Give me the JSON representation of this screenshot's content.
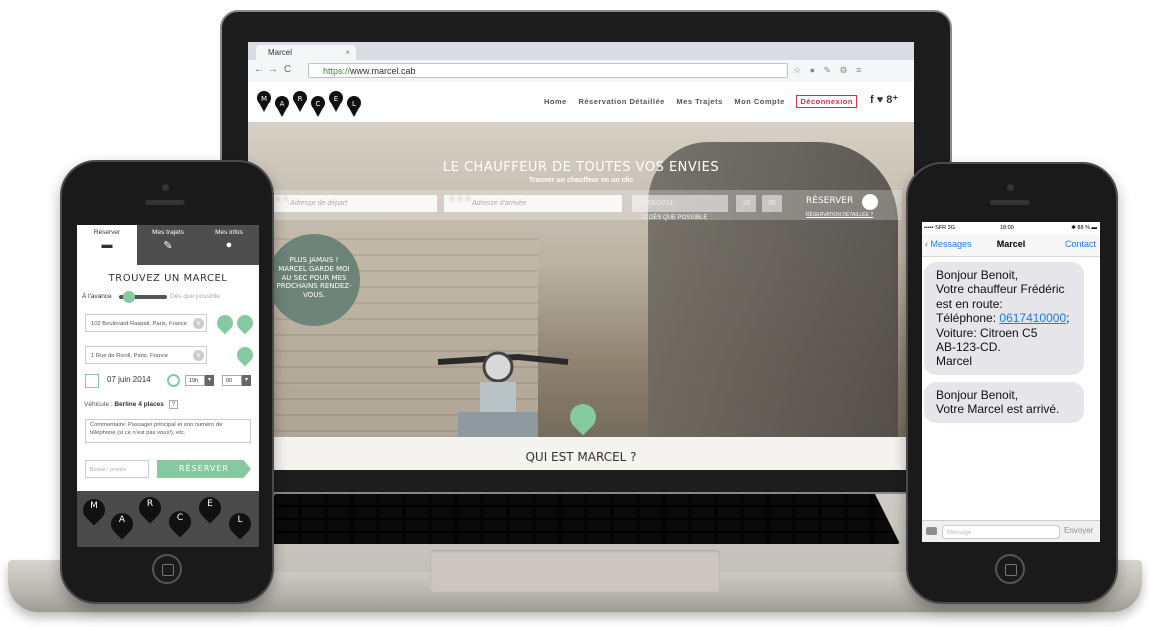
{
  "browser": {
    "tab_title": "Marcel",
    "url_secure": "https://",
    "url_rest": "www.marcel.cab"
  },
  "site": {
    "logo_letters": [
      "M",
      "A",
      "R",
      "C",
      "E",
      "L"
    ],
    "nav": [
      "Home",
      "Réservation Détaillée",
      "Mes Trajets",
      "Mon Compte"
    ],
    "logout": "Déconnexion",
    "social": "f ♥ 8⁺",
    "hero_title": "LE CHAUFFEUR DE TOUTES VOS ENVIES",
    "hero_subtitle": "Trouver un chauffeur en un clic",
    "search": {
      "departure_placeholder": "Adresse de départ",
      "arrival_placeholder": "Adresse d'arrivée",
      "date": "21/06/2014",
      "hour": "15",
      "minute": "35",
      "asap": "DÈS QUE POSSIBLE",
      "reserve": "RÉSERVER",
      "detailed": "RÉSERVATION DÉTAILLÉE ?"
    },
    "bubble_text": "PLUS JAMAIS ! MARCEL GARDE MOI AU SEC POUR MES PROCHAINS RENDEZ-VOUS.",
    "who_title": "QUI EST MARCEL ?"
  },
  "mobile_app": {
    "tabs": [
      {
        "label": "Réserver",
        "icon": "car-icon"
      },
      {
        "label": "Mes trajets",
        "icon": "edit-icon"
      },
      {
        "label": "Mes infos",
        "icon": "user-icon"
      }
    ],
    "title": "TROUVEZ UN MARCEL",
    "toggle_left": "À l'avance",
    "toggle_right": "Dès que possible",
    "departure": "102 Boulevard Raspail, Paris, France",
    "arrival": "1 Rue de Rivoli, Paris, France",
    "date": "07 juin 2014",
    "hour": "19h",
    "minute": "00",
    "vehicle_label": "Véhicule :",
    "vehicle_value": "Berline 4 places",
    "vehicle_help": "?",
    "comment": "Commentaire: Passager principal et son numéro de téléphone (si ce n'est pas vous!), etc.",
    "promo_placeholder": "Bonus / promo",
    "reserve": "RÉSERVER",
    "footer_letters": [
      "M",
      "A",
      "R",
      "C",
      "E",
      "L"
    ],
    "accent": "#86c9a1"
  },
  "sms": {
    "status_left": "••••• SFR  3G",
    "status_time": "18:00",
    "status_right": "✱ 88 % ▬",
    "back": "Messages",
    "title": "Marcel",
    "contact": "Contact",
    "msg1_lines": [
      "Bonjour Benoit,",
      "Votre chauffeur Frédéric",
      "est en route:"
    ],
    "msg1_phone_label": "Téléphone: ",
    "msg1_phone": "0617410000",
    "msg1_after": [
      "Voiture: Citroen C5",
      "AB-123-CD.",
      "Marcel"
    ],
    "msg2_lines": [
      "Bonjour Benoit,",
      "Votre Marcel est arrivé."
    ],
    "input_placeholder": "Message",
    "send": "Envoyer",
    "link_color": "#1d7cf2"
  }
}
